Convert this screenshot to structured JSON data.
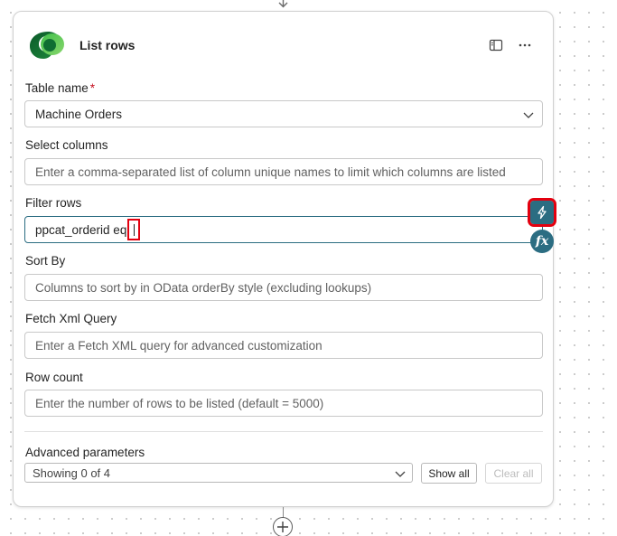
{
  "card": {
    "title": "List rows",
    "logo": "dataverse-logo",
    "actions": [
      "panel-icon",
      "more-icon"
    ]
  },
  "fields": {
    "table_name": {
      "label": "Table name",
      "required_mark": "*",
      "value": "Machine Orders"
    },
    "select_columns": {
      "label": "Select columns",
      "placeholder": "Enter a comma-separated list of column unique names to limit which columns are listed"
    },
    "filter_rows": {
      "label": "Filter rows",
      "value": "ppcat_orderid eq"
    },
    "sort_by": {
      "label": "Sort By",
      "placeholder": "Columns to sort by in OData orderBy style (excluding lookups)"
    },
    "fetch_xml": {
      "label": "Fetch Xml Query",
      "placeholder": "Enter a Fetch XML query for advanced customization"
    },
    "row_count": {
      "label": "Row count",
      "placeholder": "Enter the number of rows to be listed (default = 5000)"
    }
  },
  "advanced": {
    "label": "Advanced parameters",
    "selected": "Showing 0 of 4",
    "show_all": "Show all",
    "clear_all": "Clear all"
  },
  "side_buttons": {
    "dynamic_content_icon": "lightning-icon",
    "expression_label": "fx"
  },
  "colors": {
    "accent": "#2b6d82",
    "highlight": "#e3000f",
    "required": "#c50f1f"
  }
}
